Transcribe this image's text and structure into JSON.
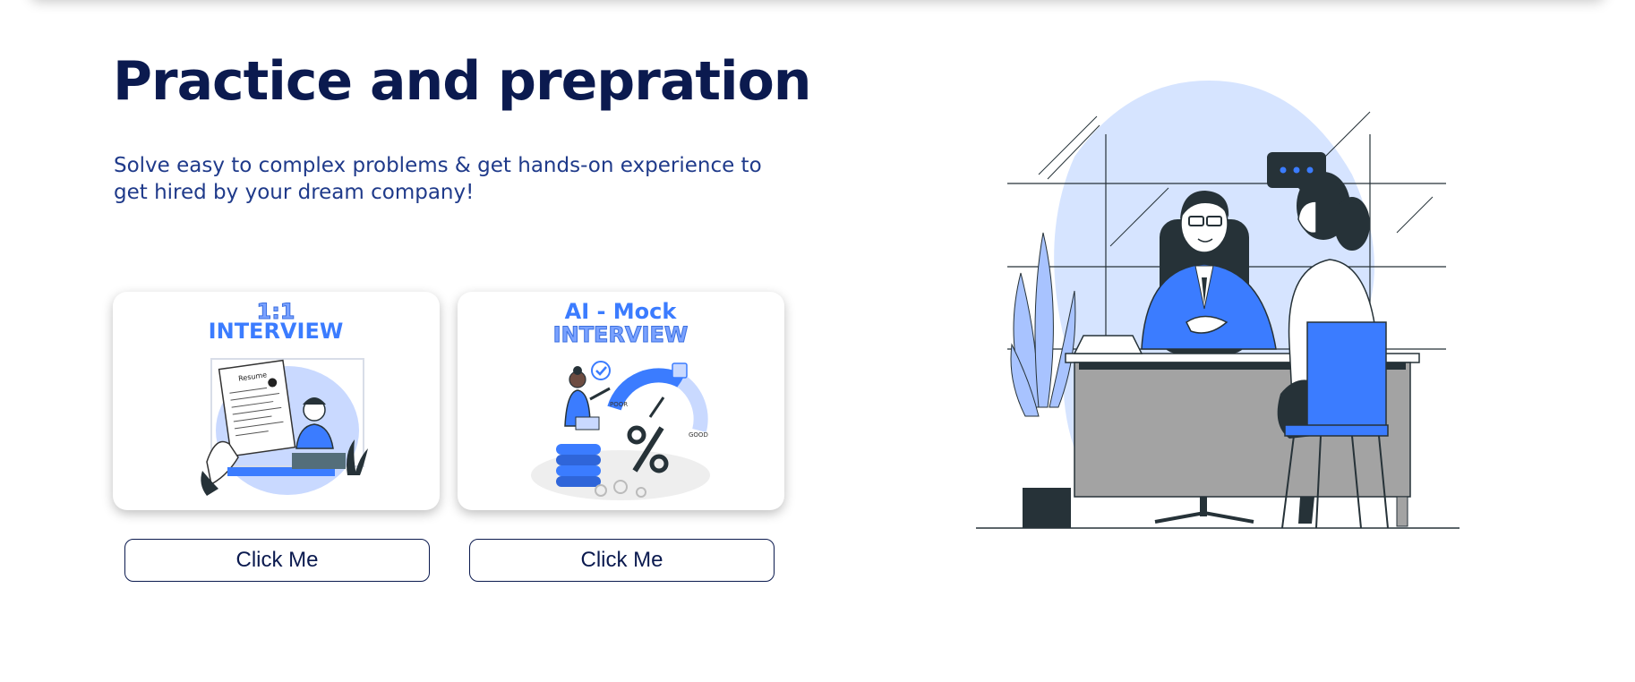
{
  "header": {
    "title": "Practice and prepration",
    "subtitle": "Solve easy to complex problems & get hands-on experience to get hired by your dream company!"
  },
  "cards": [
    {
      "heading_top": "1:1",
      "heading_bottom": "INTERVIEW",
      "doc_label": "Resume",
      "button_label": "Click Me"
    },
    {
      "heading_top": "AI - Mock",
      "heading_bottom": "INTERVIEW",
      "gauge_labels": [
        "POOR",
        "GOOD"
      ],
      "button_label": "Click Me"
    }
  ],
  "colors": {
    "title": "#0b1a4f",
    "subtitle": "#1f3a8a",
    "accent_blue": "#3b7cff",
    "light_blue": "#d6e4ff"
  },
  "icons": [
    "chat-bubble-icon",
    "check-icon",
    "percent-icon"
  ]
}
